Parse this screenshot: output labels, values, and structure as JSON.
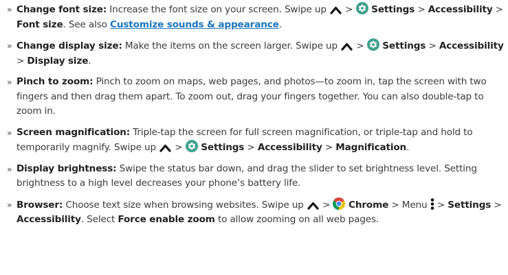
{
  "icons": {
    "swipe_up": "chevron-up-icon",
    "settings": "settings-gear-icon",
    "chrome": "chrome-icon",
    "menu": "more-vert-icon"
  },
  "colors": {
    "text": "#3a3a3a",
    "bold": "#222222",
    "link": "#1b75bb",
    "settings_icon": "#3fa08d"
  },
  "bullet": "»",
  "items": [
    {
      "name": "item-change-font-size",
      "runs": [
        {
          "b": "Change font size:"
        },
        {
          "t": " Increase the font size on your screen. Swipe up "
        },
        {
          "i": "up"
        },
        {
          "t": " > "
        },
        {
          "i": "gear"
        },
        {
          "b": " Settings"
        },
        {
          "t": " > "
        },
        {
          "b": "Accessibility"
        },
        {
          "t": " > "
        },
        {
          "b": "Font size"
        },
        {
          "t": ". See also "
        },
        {
          "l": "Customize sounds & appearance"
        },
        {
          "t": "."
        }
      ]
    },
    {
      "name": "item-change-display-size",
      "runs": [
        {
          "b": "Change display size:"
        },
        {
          "t": " Make the items on the screen larger. Swipe up "
        },
        {
          "i": "up"
        },
        {
          "t": " > "
        },
        {
          "i": "gear"
        },
        {
          "b": " Settings"
        },
        {
          "t": " > "
        },
        {
          "b": "Accessibility"
        },
        {
          "t": " > "
        },
        {
          "b": "Display size"
        },
        {
          "t": "."
        }
      ]
    },
    {
      "name": "item-pinch-to-zoom",
      "runs": [
        {
          "b": "Pinch to zoom:"
        },
        {
          "t": " Pinch to zoom on maps, web pages, and photos—to zoom in, tap the screen with two fingers and then drag them apart. To zoom out, drag your fingers together. You can also double-tap to zoom in."
        }
      ]
    },
    {
      "name": "item-screen-magnification",
      "runs": [
        {
          "b": "Screen magnification:"
        },
        {
          "t": " Triple-tap the screen for full screen magnification, or triple-tap and hold to temporarily magnify. Swipe up "
        },
        {
          "i": "up"
        },
        {
          "t": " > "
        },
        {
          "i": "gear"
        },
        {
          "b": " Settings"
        },
        {
          "t": " > "
        },
        {
          "b": "Accessibility"
        },
        {
          "t": " > "
        },
        {
          "b": "Magnification"
        },
        {
          "t": "."
        }
      ]
    },
    {
      "name": "item-display-brightness",
      "runs": [
        {
          "b": "Display brightness:"
        },
        {
          "t": " Swipe the status bar down, and drag the slider to set brightness level. Setting brightness to a high level decreases your phone’s battery life."
        }
      ]
    },
    {
      "name": "item-browser",
      "runs": [
        {
          "b": "Browser:"
        },
        {
          "t": " Choose text size when browsing websites. Swipe up "
        },
        {
          "i": "up"
        },
        {
          "t": " > "
        },
        {
          "i": "chrome"
        },
        {
          "b": " Chrome"
        },
        {
          "t": " > Menu "
        },
        {
          "i": "menu"
        },
        {
          "t": " > "
        },
        {
          "b": "Settings"
        },
        {
          "t": " > "
        },
        {
          "b": "Accessibility"
        },
        {
          "t": ". Select "
        },
        {
          "b": "Force enable zoom"
        },
        {
          "t": " to allow zooming on all web pages."
        }
      ]
    }
  ]
}
